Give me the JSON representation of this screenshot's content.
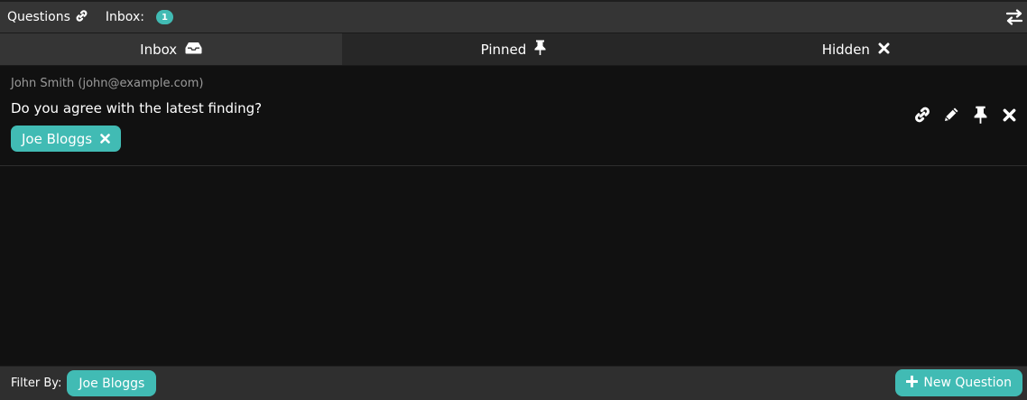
{
  "header": {
    "title": "Questions",
    "inbox_label": "Inbox:",
    "inbox_count": "1"
  },
  "tabs": [
    {
      "label": "Inbox",
      "icon": "inbox-icon",
      "active": true
    },
    {
      "label": "Pinned",
      "icon": "pin-icon",
      "active": false
    },
    {
      "label": "Hidden",
      "icon": "close-icon",
      "active": false
    }
  ],
  "question": {
    "author": "John Smith (john@example.com)",
    "text": "Do you agree with the latest finding?",
    "assignee": "Joe Bloggs",
    "actions": [
      "link-icon",
      "edit-icon",
      "pin-icon",
      "close-icon"
    ]
  },
  "footer": {
    "filter_label": "Filter By:",
    "filter_value": "Joe Bloggs",
    "new_button_label": "New Question"
  },
  "colors": {
    "accent": "#41bbb4",
    "background": "#111111",
    "toolbar": "#353535"
  }
}
